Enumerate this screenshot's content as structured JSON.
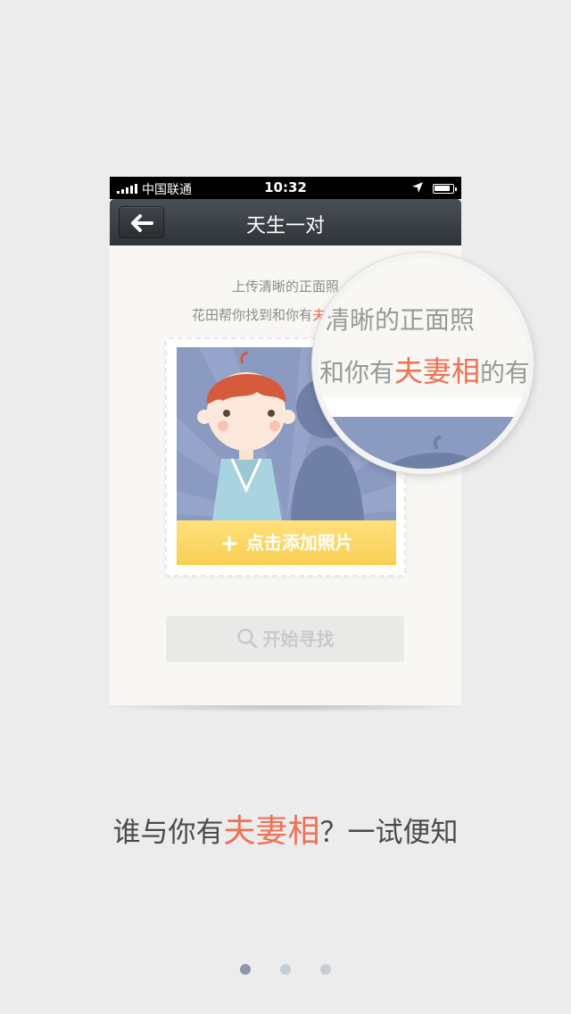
{
  "status_bar": {
    "carrier": "中国联通",
    "time": "10:32"
  },
  "navbar": {
    "title": "天生一对",
    "back_icon": "arrow-left-icon"
  },
  "upload_hint": {
    "line1": "上传清晰的正面照",
    "line2_prefix": "花田帮你找到和你有",
    "line2_accent": "夫妻相",
    "line2_suffix": "的有"
  },
  "photo_card": {
    "add_photo_label": "点击添加照片",
    "plus_icon": "plus-icon"
  },
  "start_button": {
    "label": "开始寻找",
    "icon": "search-icon"
  },
  "magnifier": {
    "line1": "清晰的正面照",
    "line2_prefix": "和你有",
    "line2_accent": "夫妻相",
    "line2_suffix": "的有"
  },
  "tagline": {
    "prefix": "谁与你有",
    "accent": "夫妻相",
    "suffix": "？一试便知"
  },
  "pagination": {
    "total": 3,
    "active_index": 0
  },
  "colors": {
    "accent": "#ef7154",
    "add_photo_bg": "#f9cf55",
    "photo_bg": "#8b9ac0",
    "navbar_bg": "#2f3439"
  }
}
